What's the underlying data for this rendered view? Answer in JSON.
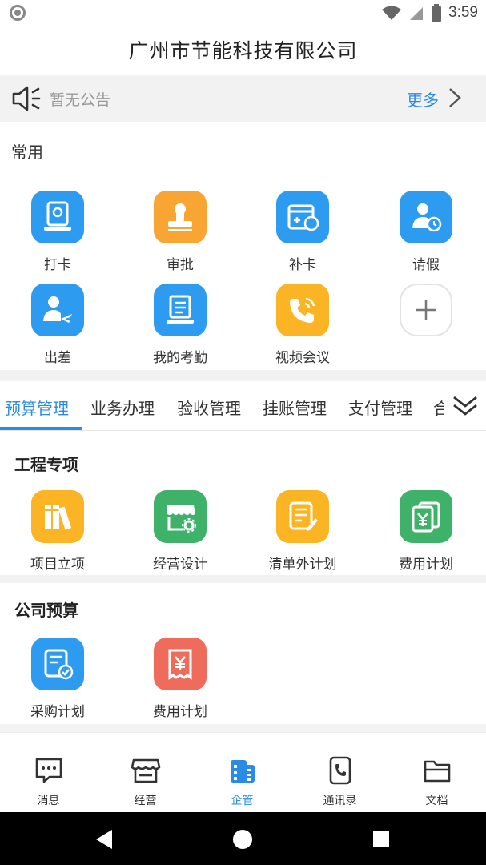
{
  "status_bar": {
    "time": "3:59"
  },
  "header": {
    "title": "广州市节能科技有限公司"
  },
  "notice": {
    "text": "暂无公告",
    "more_label": "更多"
  },
  "common": {
    "label": "常用",
    "apps": [
      {
        "label": "打卡",
        "icon": "clock-in-icon",
        "color": "#2d9cf0"
      },
      {
        "label": "审批",
        "icon": "stamp-icon",
        "color": "#f9a533"
      },
      {
        "label": "补卡",
        "icon": "supplement-card-icon",
        "color": "#2d9cf0"
      },
      {
        "label": "请假",
        "icon": "leave-icon",
        "color": "#2d9cf0"
      },
      {
        "label": "出差",
        "icon": "business-trip-icon",
        "color": "#2d9cf0"
      },
      {
        "label": "我的考勤",
        "icon": "attendance-icon",
        "color": "#2d9cf0"
      },
      {
        "label": "视频会议",
        "icon": "video-call-icon",
        "color": "#fbb424"
      }
    ]
  },
  "tabs": {
    "items": [
      "预算管理",
      "业务办理",
      "验收管理",
      "挂账管理",
      "支付管理",
      "合"
    ],
    "active_index": 0
  },
  "group1": {
    "title": "工程专项",
    "apps": [
      {
        "label": "项目立项",
        "icon": "books-icon",
        "color": "#fbb424"
      },
      {
        "label": "经营设计",
        "icon": "shop-settings-icon",
        "color": "#3fb26a"
      },
      {
        "label": "清单外计划",
        "icon": "edit-list-icon",
        "color": "#fbb424"
      },
      {
        "label": "费用计划",
        "icon": "yuan-cards-icon",
        "color": "#3fb26a"
      }
    ]
  },
  "group2": {
    "title": "公司预算",
    "apps": [
      {
        "label": "采购计划",
        "icon": "purchase-plan-icon",
        "color": "#2d9cf0"
      },
      {
        "label": "费用计划",
        "icon": "yuan-receipt-icon",
        "color": "#ef6b5b"
      }
    ]
  },
  "bottom_nav": {
    "items": [
      {
        "label": "消息",
        "icon": "message-icon"
      },
      {
        "label": "经营",
        "icon": "store-icon"
      },
      {
        "label": "企管",
        "icon": "management-icon"
      },
      {
        "label": "通讯录",
        "icon": "contacts-phone-icon"
      },
      {
        "label": "文档",
        "icon": "folder-icon"
      }
    ],
    "active_index": 2
  },
  "colors": {
    "accent": "#2b8ae6",
    "background_gray": "#f2f2f2"
  }
}
